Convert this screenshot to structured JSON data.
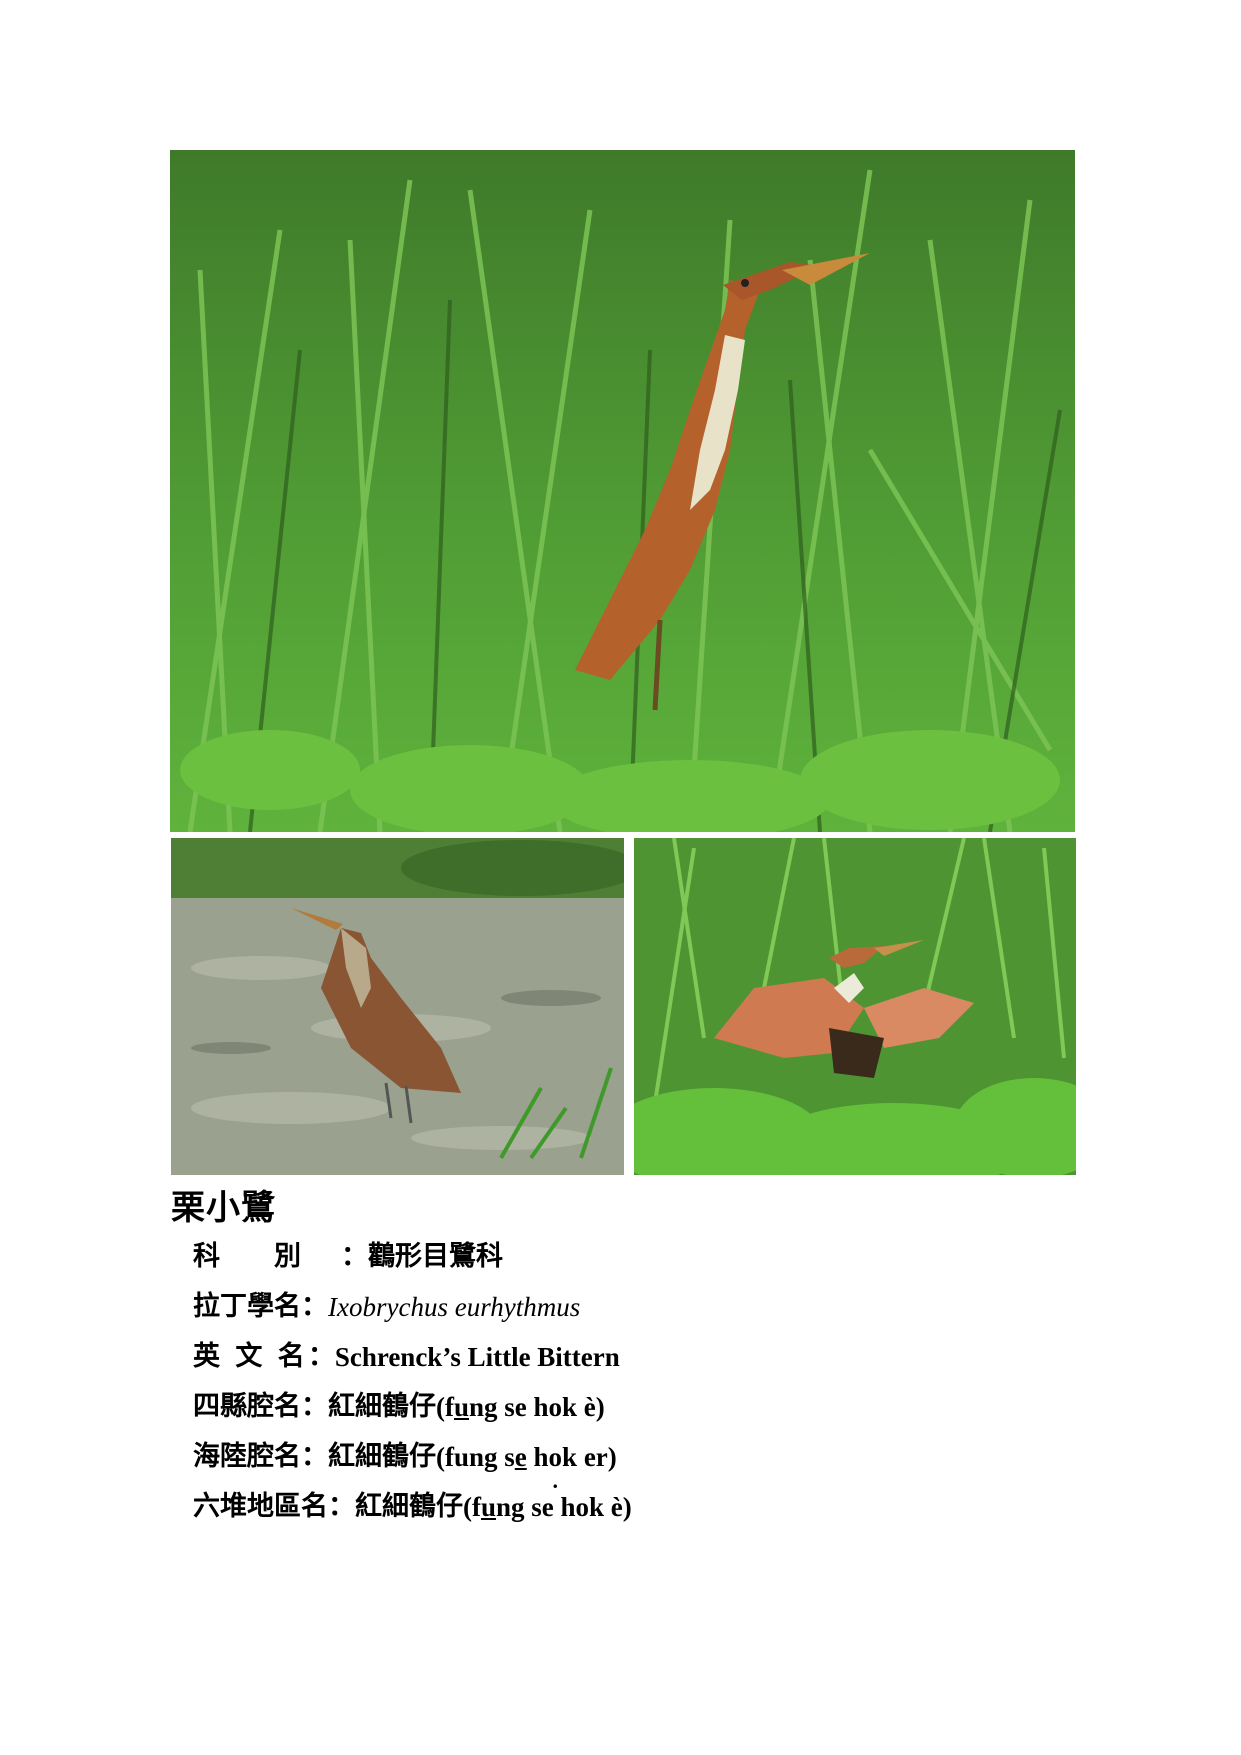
{
  "photos": {
    "main": {
      "alt": "栗小鷺"
    },
    "water": {
      "alt": "栗小鷺"
    },
    "wings": {
      "alt": "栗小鷺"
    }
  },
  "species": {
    "name": "栗小鷺",
    "rows": [
      {
        "label": "科　　別",
        "colon": "：",
        "value": "鸛形目鷺科"
      },
      {
        "label": "拉丁學名",
        "colon": "：",
        "value": "Ixobrychus eurhythmus"
      },
      {
        "label": "英 文 名",
        "colon": "：",
        "value": "Schrenck’s Little Bittern"
      },
      {
        "label": "四縣腔名",
        "colon": "：",
        "value_cjk": "紅細鶴仔",
        "value_roman": [
          "(f",
          "u",
          "ng se hok è)"
        ]
      },
      {
        "label": "海陸腔名",
        "colon": "：",
        "value_cjk": "紅細鶴仔",
        "value_roman": [
          "(fung s",
          "e",
          " h",
          "o",
          "k er)"
        ]
      },
      {
        "label": "六堆地區名",
        "colon": "：",
        "value_cjk": "紅細鶴仔",
        "value_roman": [
          "(f",
          "u",
          "ng se hok è)"
        ]
      }
    ]
  }
}
